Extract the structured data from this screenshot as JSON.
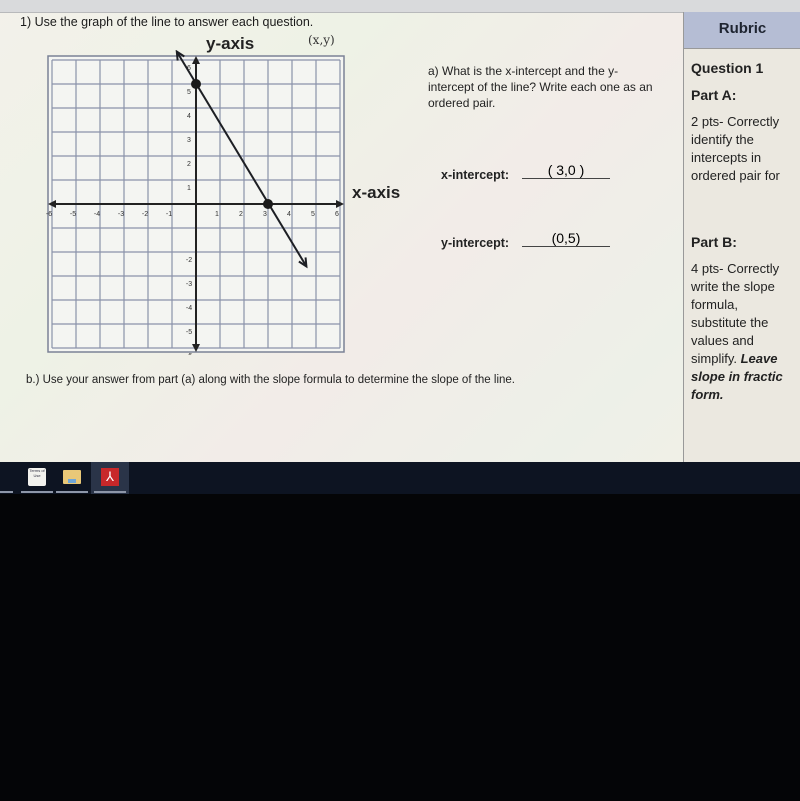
{
  "worksheet": {
    "question_title": "1) Use the graph of the line to answer each question.",
    "yaxis_label": "y-axis",
    "xy_note": "(x,y)",
    "xaxis_label": "x-axis",
    "part_a_prompt": "a) What is the x-intercept and the y-intercept of the line? Write each one as an ordered pair.",
    "x_intercept_label": "x-intercept:",
    "x_intercept_answer": "( 3,0 )",
    "y_intercept_label": "y-intercept:",
    "y_intercept_answer": "(0,5)",
    "part_b_prompt": "b.) Use your answer from part (a) along with the slope formula to determine the slope of the line."
  },
  "rubric": {
    "header": "Rubric",
    "question": "Question 1",
    "part_a_title": "Part A:",
    "part_a_lines": [
      "2 pts- Correctly",
      "identify the",
      "intercepts in",
      "ordered pair for"
    ],
    "part_b_title": "Part B:",
    "part_b_lines": [
      "4 pts- Correctly",
      "write the slope",
      "formula,",
      "substitute the",
      "values and",
      "simplify.  "
    ],
    "part_b_emphasis": [
      "Leave",
      "slope in fractic",
      "form."
    ]
  },
  "taskbar": {
    "items": [
      {
        "name": "terms-of-use-icon",
        "label": "Terms of Use"
      },
      {
        "name": "file-explorer-icon",
        "label": ""
      },
      {
        "name": "pdf-reader-icon",
        "label": ""
      }
    ]
  },
  "chart_data": {
    "type": "line",
    "title": "",
    "xlabel": "x-axis",
    "ylabel": "y-axis",
    "xlim": [
      -6,
      6
    ],
    "ylim": [
      -6,
      6
    ],
    "x_ticks": [
      -6,
      -5,
      -4,
      -3,
      -2,
      -1,
      1,
      2,
      3,
      4,
      5,
      6
    ],
    "y_ticks": [
      -6,
      -5,
      -4,
      -3,
      -2,
      1,
      2,
      3,
      4,
      5,
      6
    ],
    "grid": true,
    "line": {
      "through": [
        [
          0,
          5
        ],
        [
          3,
          0
        ]
      ],
      "from": [
        -0.8,
        6.35
      ],
      "to": [
        4.6,
        -2.6
      ]
    },
    "points": [
      {
        "x": 0,
        "y": 5
      },
      {
        "x": 3,
        "y": 0
      }
    ]
  }
}
